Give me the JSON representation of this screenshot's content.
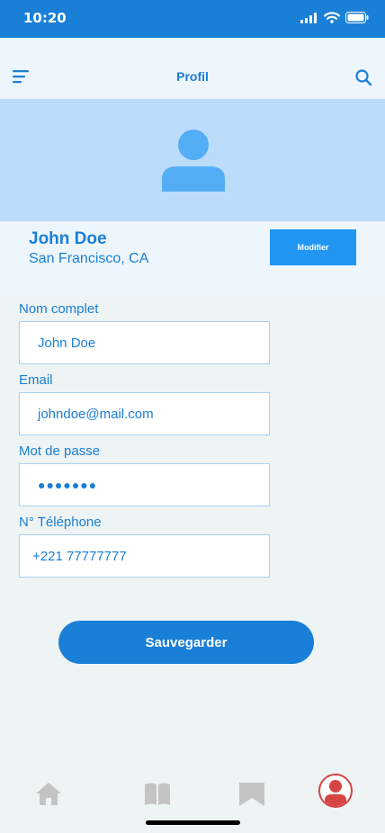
{
  "status_bar": {
    "time": "10:20"
  },
  "header": {
    "title": "Profil"
  },
  "profile": {
    "name": "John Doe",
    "location": "San Francisco, CA",
    "edit_label": "Modifier"
  },
  "form": {
    "full_name": {
      "label": "Nom complet",
      "value": "John Doe"
    },
    "email": {
      "label": "Email",
      "value": "johndoe@mail.com"
    },
    "password": {
      "label": "Mot de passe",
      "value": "●●●●●●●"
    },
    "phone": {
      "label": "N° Téléphone",
      "value": "+221 77777777"
    }
  },
  "save_label": "Sauvegarder",
  "bottom_nav": {
    "items": [
      {
        "icon": "home-icon"
      },
      {
        "icon": "book-icon"
      },
      {
        "icon": "bookmark-icon"
      },
      {
        "icon": "profile-icon",
        "active": true
      }
    ]
  },
  "colors": {
    "primary": "#1a7fd6",
    "banner": "#bbdcfa",
    "active_nav": "#d64545",
    "inactive_nav": "#c4c4c4"
  }
}
